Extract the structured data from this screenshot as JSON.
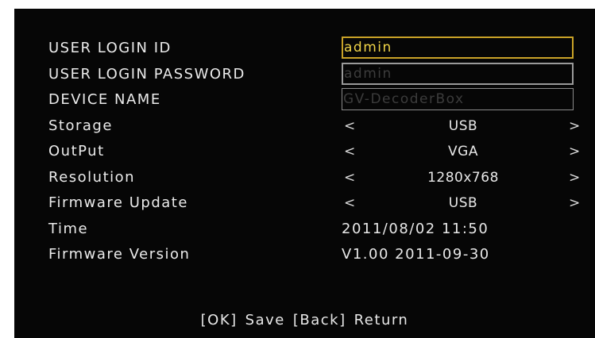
{
  "settings": {
    "login_id": {
      "label": "USER LOGIN ID",
      "value": "admin"
    },
    "login_password": {
      "label": "USER LOGIN PASSWORD",
      "value": "admin"
    },
    "device_name": {
      "label": "DEVICE NAME",
      "value": "GV-DecoderBox"
    },
    "storage": {
      "label": "Storage",
      "value": "USB"
    },
    "output": {
      "label": "OutPut",
      "value": "VGA"
    },
    "resolution": {
      "label": "Resolution",
      "value": "1280x768"
    },
    "firmware_update": {
      "label": "Firmware Update",
      "value": "USB"
    },
    "time": {
      "label": "Time",
      "value": "2011/08/02 11:50"
    },
    "firmware_version": {
      "label": "Firmware Version",
      "value": "V1.00 2011-09-30"
    }
  },
  "arrows": {
    "left": "<",
    "right": ">"
  },
  "footer": {
    "ok_key": "[OK]",
    "ok_action": "Save",
    "back_key": "[Back]",
    "back_action": "Return"
  },
  "colors": {
    "background": "#060606",
    "text": "#e8e8e8",
    "focus_border": "#c9a227",
    "focus_text": "#f0d448",
    "dim_text": "#3c3c3c"
  }
}
